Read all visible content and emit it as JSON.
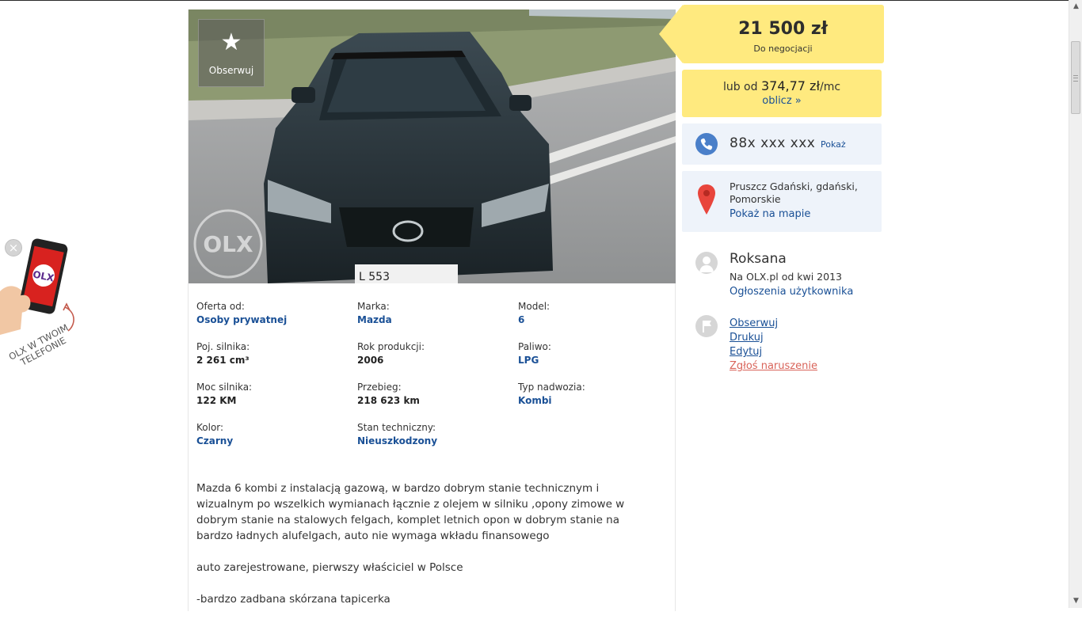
{
  "gallery": {
    "watch_label": "Obserwuj",
    "watermark": "OLX",
    "plate_text": "L  553"
  },
  "params": [
    {
      "label": "Oferta od:",
      "value": "Osoby prywatnej",
      "link": true
    },
    {
      "label": "Marka:",
      "value": "Mazda",
      "link": true
    },
    {
      "label": "Model:",
      "value": "6",
      "link": true
    },
    {
      "label": "Poj. silnika:",
      "value": "2 261 cm³",
      "link": false
    },
    {
      "label": "Rok produkcji:",
      "value": "2006",
      "link": false
    },
    {
      "label": "Paliwo:",
      "value": "LPG",
      "link": true
    },
    {
      "label": "Moc silnika:",
      "value": "122 KM",
      "link": false
    },
    {
      "label": "Przebieg:",
      "value": "218 623 km",
      "link": false
    },
    {
      "label": "Typ nadwozia:",
      "value": "Kombi",
      "link": true
    },
    {
      "label": "Kolor:",
      "value": "Czarny",
      "link": true
    },
    {
      "label": "Stan techniczny:",
      "value": "Nieuszkodzony",
      "link": true
    }
  ],
  "description": {
    "p1": "Mazda 6 kombi z instalacją gazową, w bardzo dobrym stanie technicznym i wizualnym po wszelkich wymianach łącznie z olejem w silniku ,opony zimowe w dobrym stanie na stalowych felgach, komplet letnich opon w dobrym stanie na bardzo ładnych alufelgach, auto nie wymaga wkładu finansowego",
    "p2": "auto zarejestrowane, pierwszy właściciel w Polsce",
    "p3": "-bardzo zadbana skórzana tapicerka"
  },
  "price": {
    "amount": "21 500 zł",
    "note": "Do negocjacji"
  },
  "installment": {
    "prefix": "lub od ",
    "amount": "374,77 zł",
    "suffix": "/mc",
    "link": "oblicz »"
  },
  "phone": {
    "number": "88x xxx xxx",
    "show": "Pokaż"
  },
  "location": {
    "text": "Pruszcz Gdański, gdański, Pomorskie",
    "map_link": "Pokaż na mapie"
  },
  "seller": {
    "name": "Roksana",
    "since": "Na OLX.pl od kwi 2013",
    "ads_link": "Ogłoszenia użytkownika"
  },
  "actions": {
    "watch": "Obserwuj",
    "print": "Drukuj",
    "edit": "Edytuj",
    "report": "Zgłoś naruszenie"
  },
  "promo": {
    "close": "×",
    "logo": "OLX",
    "line1": "OLX W TWOIM",
    "line2": "TELEFONIE"
  },
  "colors": {
    "accent_yellow": "#ffea7f",
    "link_blue": "#1a5096",
    "info_bg": "#eef3fa",
    "report_red": "#d9645a"
  }
}
